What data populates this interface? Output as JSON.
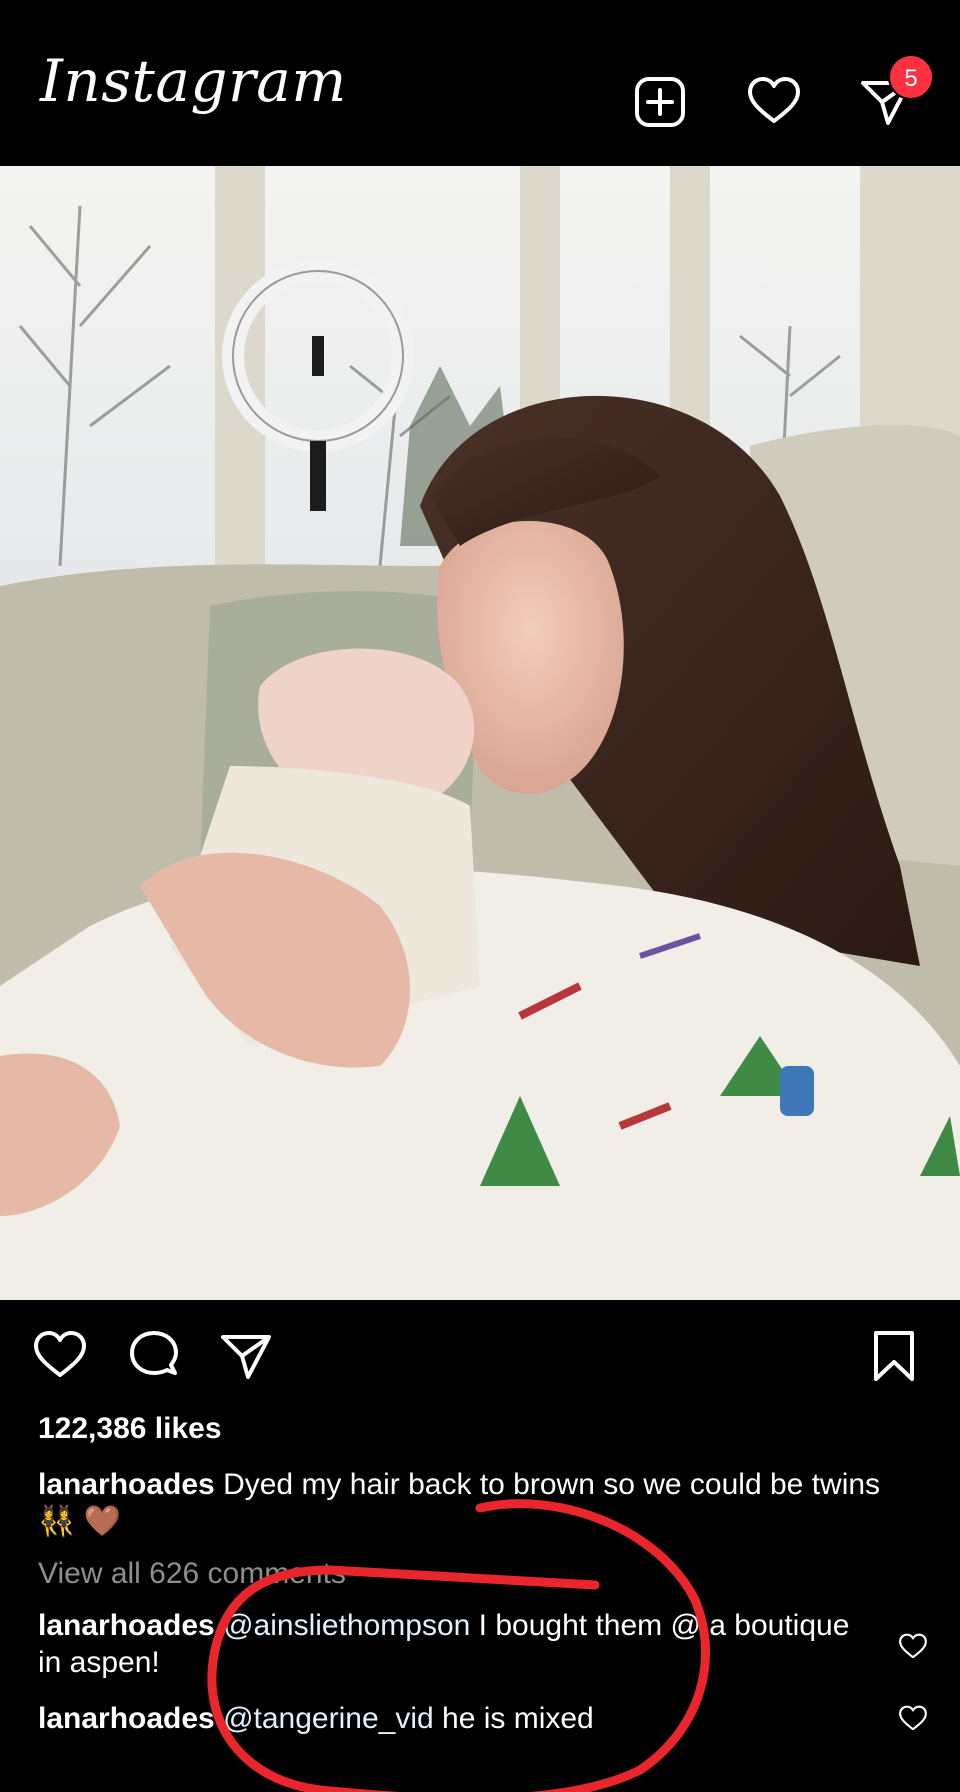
{
  "header": {
    "logo": "Instagram",
    "notification_count": "5"
  },
  "post": {
    "likes": "122,386 likes",
    "caption": {
      "username": "lanarhoades",
      "text": " Dyed my hair back to brown so we could be twins 👯‍♀️ 🤎"
    },
    "view_all_comments": "View all 626 comments",
    "comments": [
      {
        "username": "lanarhoades",
        "mention": "@ainsliethompson",
        "text": " I bought them @ a boutique in aspen!"
      },
      {
        "username": "lanarhoades",
        "mention": "@tangerine_vid",
        "text": " he is mixed"
      }
    ]
  },
  "colors": {
    "background": "#000000",
    "badge": "#ff3040",
    "annotation": "#e8262b",
    "secondary_text": "#8e8e8e"
  }
}
